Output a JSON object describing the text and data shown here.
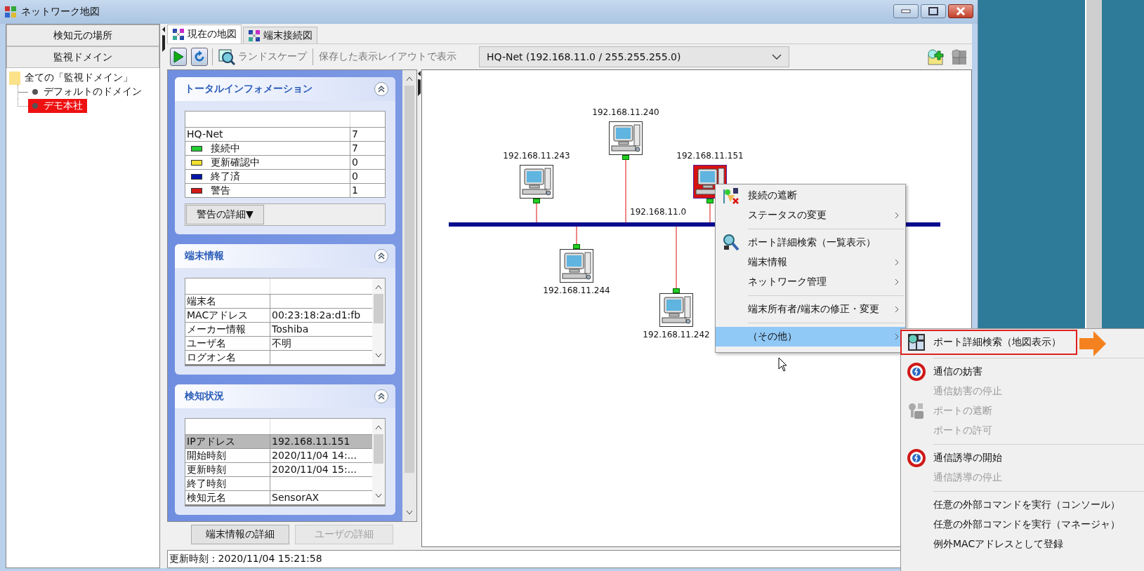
{
  "window": {
    "title": "ネットワーク地図"
  },
  "left_panel": {
    "sections": [
      {
        "label": "検知元の場所"
      },
      {
        "label": "監視ドメイン"
      }
    ],
    "tree": [
      {
        "label": "全ての「監視ドメイン」",
        "children": [
          {
            "label": "デフォルトのドメイン",
            "selected": false
          },
          {
            "label": "デモ本社",
            "selected": true
          }
        ]
      }
    ]
  },
  "tabs": [
    {
      "label": "現在の地図",
      "selected": true
    },
    {
      "label": "端末接続図",
      "selected": false
    }
  ],
  "toolbar": {
    "landscape": "ランドスケープ",
    "saved_layout": "保存した表示レイアウトで表示",
    "network_select": "HQ-Net (192.168.11.0 / 255.255.255.0)"
  },
  "panels": [
    {
      "title": "トータルインフォメーション",
      "kind": "summary",
      "rows": [
        {
          "label": "HQ-Net",
          "value": "7"
        },
        {
          "label": "接続中",
          "value": "7",
          "color": "#22cc33"
        },
        {
          "label": "更新確認中",
          "value": "0",
          "color": "#f0e030"
        },
        {
          "label": "終了済",
          "value": "0",
          "color": "#0018a8"
        },
        {
          "label": "警告",
          "value": "1",
          "color": "#d01818"
        }
      ],
      "button": "警告の詳細▼"
    },
    {
      "title": "端末情報",
      "kind": "scroll",
      "rows": [
        {
          "label": "端末名",
          "selected": false
        },
        {
          "label": "MACアドレス",
          "value": "00:23:18:2a:d1:fb",
          "selected": false
        },
        {
          "label": "メーカー情報",
          "value": "Toshiba",
          "selected": false
        },
        {
          "label": "ユーザ名",
          "value": "不明",
          "selected": false
        },
        {
          "label": "ログオン名",
          "selected": false
        }
      ]
    },
    {
      "title": "検知状況",
      "kind": "scroll",
      "rows": [
        {
          "label": "IPアドレス",
          "value": "192.168.11.151",
          "selected": true
        },
        {
          "label": "開始時刻",
          "value": "2020/11/04 14:...",
          "selected": false
        },
        {
          "label": "更新時刻",
          "value": "2020/11/04 15:...",
          "selected": false
        },
        {
          "label": "終了時刻",
          "selected": false
        },
        {
          "label": "検知元名",
          "value": "SensorAX",
          "selected": false
        }
      ]
    }
  ],
  "bottom_buttons": [
    {
      "label": "端末情報の詳細",
      "disabled": false
    },
    {
      "label": "ユーザの詳細",
      "disabled": true
    }
  ],
  "map": {
    "network": "192.168.11.0",
    "nodes": [
      {
        "label": "192.168.11.243",
        "selected": false
      },
      {
        "label": "192.168.11.240",
        "selected": false
      },
      {
        "label": "192.168.11.151",
        "selected": true
      },
      {
        "label": "192.168.11.244",
        "selected": false
      },
      {
        "label": "192.168.11.242",
        "selected": false
      }
    ]
  },
  "context_menu": [
    {
      "kind": "item",
      "label": "接続の遮断",
      "submenu": false,
      "selected": false,
      "disabled": false
    },
    {
      "kind": "item",
      "label": "ステータスの変更",
      "submenu": true,
      "selected": false,
      "disabled": false
    },
    {
      "kind": "separator"
    },
    {
      "kind": "item",
      "label": "ポート詳細検索（一覧表示）",
      "submenu": false,
      "selected": false,
      "disabled": false
    },
    {
      "kind": "item",
      "label": "端末情報",
      "submenu": true,
      "selected": false,
      "disabled": false
    },
    {
      "kind": "item",
      "label": "ネットワーク管理",
      "submenu": true,
      "selected": false,
      "disabled": false
    },
    {
      "kind": "separator"
    },
    {
      "kind": "item",
      "label": "端末所有者/端末の修正・変更",
      "submenu": true,
      "selected": false,
      "disabled": false
    },
    {
      "kind": "separator"
    },
    {
      "kind": "item",
      "label": "（その他）",
      "submenu": true,
      "selected": true,
      "disabled": false
    }
  ],
  "submenu": [
    {
      "kind": "item",
      "label": "ポート詳細検索（地図表示）",
      "disabled": false,
      "annotated": true
    },
    {
      "kind": "separator"
    },
    {
      "kind": "item",
      "label": "通信の妨害",
      "disabled": false,
      "annotated": false
    },
    {
      "kind": "item",
      "label": "通信妨害の停止",
      "disabled": true,
      "annotated": false
    },
    {
      "kind": "item",
      "label": "ポートの遮断",
      "disabled": true,
      "annotated": false
    },
    {
      "kind": "item",
      "label": "ポートの許可",
      "disabled": true,
      "annotated": false
    },
    {
      "kind": "separator"
    },
    {
      "kind": "item",
      "label": "通信誘導の開始",
      "disabled": false,
      "annotated": false
    },
    {
      "kind": "item",
      "label": "通信誘導の停止",
      "disabled": true,
      "annotated": false
    },
    {
      "kind": "separator"
    },
    {
      "kind": "item",
      "label": "任意の外部コマンドを実行（コンソール）",
      "disabled": false,
      "annotated": false
    },
    {
      "kind": "item",
      "label": "任意の外部コマンドを実行（マネージャ）",
      "disabled": false,
      "annotated": false
    },
    {
      "kind": "item",
      "label": "例外MACアドレスとして登録",
      "disabled": false,
      "annotated": false
    }
  ],
  "status_bar": "更新時刻 : 2020/11/04 15:21:58"
}
